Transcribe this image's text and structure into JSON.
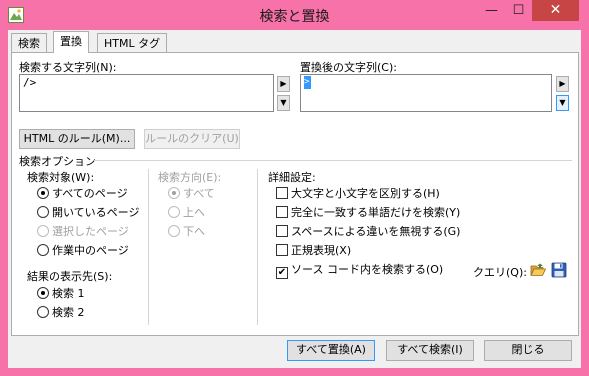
{
  "window": {
    "title": "検索と置換",
    "minimize": "—",
    "maximize": "☐",
    "close": "✕"
  },
  "tabs": [
    {
      "label": "検索"
    },
    {
      "label": "置換"
    },
    {
      "label": "HTML タグ"
    }
  ],
  "search": {
    "label": "検索する文字列(N):",
    "value": "/>"
  },
  "replace": {
    "label": "置換後の文字列(C):",
    "value": ""
  },
  "buttons": {
    "html_rules": "HTML のルール(M)...",
    "clear_rules": "ルールのクリア(U)",
    "replace_all": "すべて置換(A)",
    "find_all": "すべて検索(I)",
    "close": "閉じる"
  },
  "options": {
    "section_label": "検索オプション",
    "target_label": "検索対象(W):",
    "targets": [
      "すべてのページ",
      "開いているページ",
      "選択したページ",
      "作業中のページ"
    ],
    "direction_label": "検索方向(E):",
    "directions": [
      "すべて",
      "上へ",
      "下へ"
    ],
    "results_label": "結果の表示先(S):",
    "results": [
      "検索 1",
      "検索 2"
    ],
    "details_label": "詳細設定:",
    "checkboxes": [
      {
        "label": "大文字と小文字を区別する(H)",
        "checked": false
      },
      {
        "label": "完全に一致する単語だけを検索(Y)",
        "checked": false
      },
      {
        "label": "スペースによる違いを無視する(G)",
        "checked": false
      },
      {
        "label": "正規表現(X)",
        "checked": false
      },
      {
        "label": "ソース コード内を検索する(O)",
        "checked": true
      }
    ],
    "query_label": "クエリ(Q):"
  },
  "icons": {
    "open_folder": "open-folder-icon",
    "save": "save-icon"
  },
  "colors": {
    "window_frame": "#f672a8",
    "close_button": "#c74545",
    "selection": "#3399ff"
  }
}
